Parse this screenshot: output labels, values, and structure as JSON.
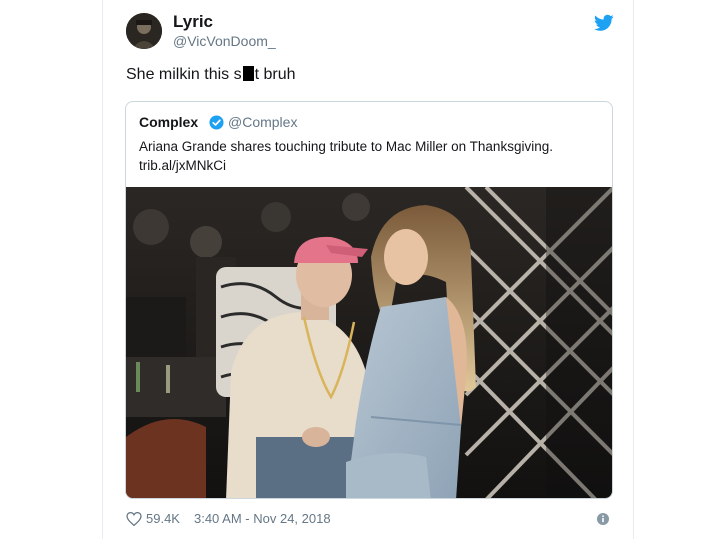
{
  "tweet": {
    "author_name": "Lyric",
    "author_handle": "@VicVonDoom_",
    "text_before": "She milkin this s",
    "text_after": "t bruh",
    "icons": [
      "twitter-bird-icon",
      "heart-icon",
      "info-icon"
    ]
  },
  "quoted": {
    "author_name": "Complex",
    "author_handle": "@Complex",
    "text": "Ariana Grande shares touching tribute to Mac Miller on Thanksgiving.",
    "link": "trib.al/jxMNkCi",
    "icons": [
      "verified-badge-icon"
    ]
  },
  "footer": {
    "likes": "59.4K",
    "timestamp": "3:40 AM - Nov 24, 2018"
  },
  "colors": {
    "twitter_blue": "#1da1f2",
    "text_primary": "#14171a",
    "text_secondary": "#657786",
    "border": "#ccd6dd"
  }
}
